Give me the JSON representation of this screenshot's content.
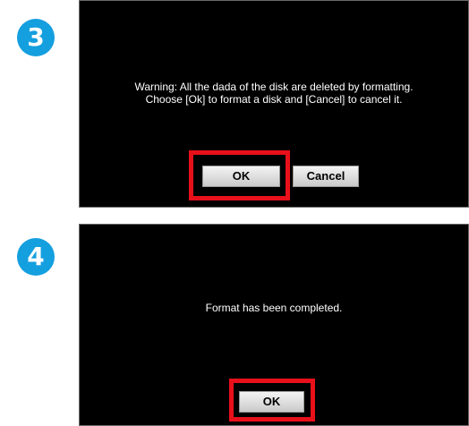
{
  "steps": [
    {
      "number": "3",
      "message_line1": "Warning: All the dada of the disk are deleted by formatting.",
      "message_line2": "Choose [Ok] to format a disk and [Cancel] to cancel it.",
      "ok_label": "OK",
      "cancel_label": "Cancel"
    },
    {
      "number": "4",
      "message": "Format has been completed.",
      "ok_label": "OK"
    }
  ],
  "colors": {
    "badge": "#149fdf",
    "highlight": "#e8101a",
    "screen_background": "#000000"
  }
}
